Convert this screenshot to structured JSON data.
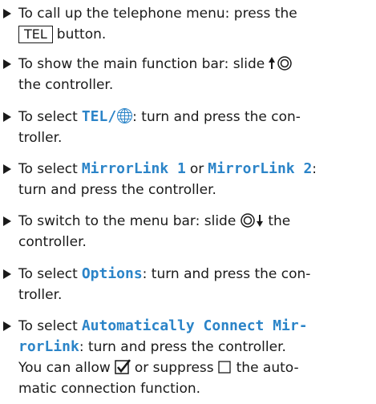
{
  "steps": [
    {
      "pre": "To call up the telephone menu: press the",
      "key": "TEL",
      "post": "button."
    },
    {
      "pre": "To show the main function bar: slide",
      "icon": "slide-up-controller-icon",
      "post": "the controller."
    },
    {
      "pre": "To select",
      "menu": "TEL/",
      "icon": "globe-icon",
      "post": ": turn and press the con-",
      "post2": "troller."
    },
    {
      "pre": "To select",
      "menu1": "MirrorLink 1",
      "mid": "or",
      "menu2": "MirrorLink 2",
      "post": ":",
      "post2": "turn and press the controller."
    },
    {
      "pre": "To switch to the menu bar: slide",
      "icon": "slide-down-controller-icon",
      "post": "the",
      "post2": "controller."
    },
    {
      "pre": "To select",
      "menu": "Options",
      "post": ": turn and press the con-",
      "post2": "troller."
    },
    {
      "pre": "To select",
      "menu_line1": "Automatically Connect Mir-",
      "menu_line2": "rorLink",
      "post": ": turn and press the controller.",
      "note_pre": "You can allow",
      "check_icon": "checked-box-icon",
      "note_mid": "or suppress",
      "uncheck_icon": "unchecked-box-icon",
      "note_post": "the auto-",
      "note_line2": "matic connection function."
    }
  ],
  "colors": {
    "accent": "#2b84c8",
    "text": "#1a1a1a"
  }
}
